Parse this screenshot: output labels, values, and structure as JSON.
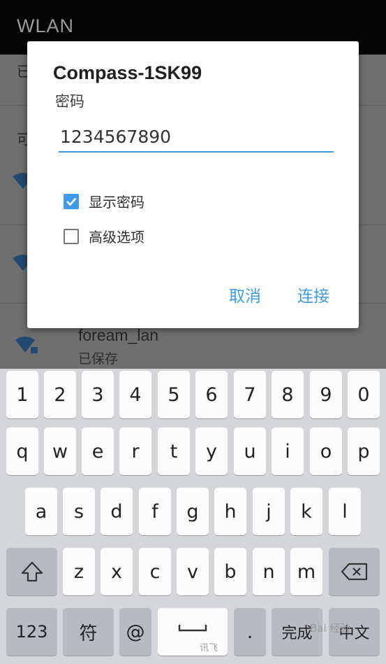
{
  "app_bar": {
    "title": "WLAN"
  },
  "background_list": {
    "saved_prefix": "已",
    "available_prefix": "可",
    "network_name": "foream_lan",
    "network_status": "已保存"
  },
  "dialog": {
    "title": "Compass-1SK99",
    "password_label": "密码",
    "password_value": "1234567890",
    "show_password_label": "显示密码",
    "show_password_checked": true,
    "advanced_label": "高级选项",
    "advanced_checked": false,
    "cancel_label": "取消",
    "connect_label": "连接"
  },
  "keyboard": {
    "row_numbers": [
      "1",
      "2",
      "3",
      "4",
      "5",
      "6",
      "7",
      "8",
      "9",
      "0"
    ],
    "row_1": [
      "q",
      "w",
      "e",
      "r",
      "t",
      "y",
      "u",
      "i",
      "o",
      "p"
    ],
    "row_2": [
      "a",
      "s",
      "d",
      "f",
      "g",
      "h",
      "j",
      "k",
      "l"
    ],
    "row_3": [
      "z",
      "x",
      "c",
      "v",
      "b",
      "n",
      "m"
    ],
    "numbers_key": "123",
    "symbols_key": "符",
    "at_key": "@",
    "period_key": ".",
    "done_key": "完成",
    "lang_key": "中文",
    "ime_brand": "讯飞",
    "watermark": "Bai 经验"
  },
  "colors": {
    "accent": "#3d9be9",
    "keyboard_bg": "#d4d6da",
    "key_light": "#fcfcfc",
    "key_dark": "#b7bac0"
  },
  "icons": [
    "wifi-icon",
    "shift-icon",
    "backspace-icon",
    "space-bar-icon",
    "check-icon"
  ]
}
